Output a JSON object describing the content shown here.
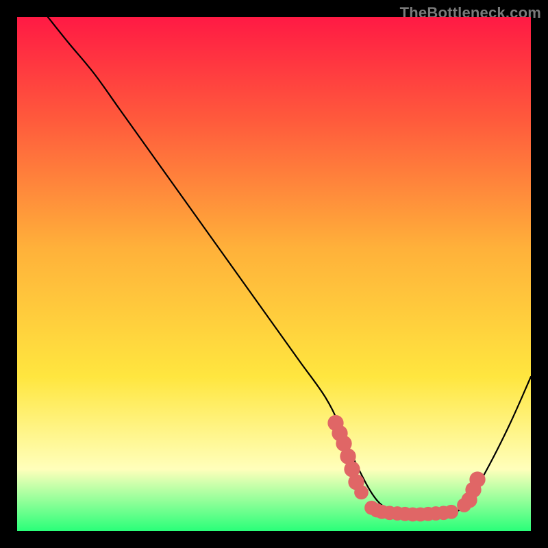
{
  "watermark": "TheBottleneck.com",
  "colors": {
    "background": "#000000",
    "gradient_top": "#ff1a44",
    "gradient_upper": "#ff5a3c",
    "gradient_mid": "#ffb13a",
    "gradient_lower": "#ffe63f",
    "gradient_pale": "#ffffbb",
    "gradient_bottom": "#2aff79",
    "curve": "#000000",
    "dots": "#e06666",
    "watermark": "#7a7a7a"
  },
  "chart_data": {
    "type": "line",
    "title": "",
    "xlabel": "",
    "ylabel": "",
    "xlim": [
      0,
      100
    ],
    "ylim": [
      0,
      100
    ],
    "grid": false,
    "legend": false,
    "series": [
      {
        "name": "bottleneck_curve",
        "x": [
          6,
          10,
          15,
          20,
          25,
          30,
          35,
          40,
          45,
          50,
          55,
          60,
          63,
          66,
          70,
          74,
          78,
          82,
          86,
          88,
          92,
          96,
          100
        ],
        "y": [
          100,
          95,
          89,
          82,
          75,
          68,
          61,
          54,
          47,
          40,
          33,
          26,
          20,
          13,
          6,
          3.5,
          3,
          3,
          4,
          6,
          13,
          21,
          30
        ]
      }
    ],
    "scatter_points": {
      "name": "highlight_dots",
      "points": [
        {
          "x": 62,
          "y": 21,
          "r": 1.2
        },
        {
          "x": 62.8,
          "y": 19,
          "r": 1.2
        },
        {
          "x": 63.6,
          "y": 17,
          "r": 1.2
        },
        {
          "x": 64.4,
          "y": 14.5,
          "r": 1.2
        },
        {
          "x": 65.2,
          "y": 12,
          "r": 1.2
        },
        {
          "x": 66,
          "y": 9.5,
          "r": 1.2
        },
        {
          "x": 67,
          "y": 7.5,
          "r": 1.0
        },
        {
          "x": 69,
          "y": 4.5,
          "r": 1.0
        },
        {
          "x": 70,
          "y": 4,
          "r": 1.0
        },
        {
          "x": 71,
          "y": 3.7,
          "r": 1.0
        },
        {
          "x": 72.5,
          "y": 3.5,
          "r": 1.0
        },
        {
          "x": 74,
          "y": 3.4,
          "r": 1.0
        },
        {
          "x": 75.5,
          "y": 3.3,
          "r": 1.0
        },
        {
          "x": 77,
          "y": 3.2,
          "r": 1.0
        },
        {
          "x": 78.5,
          "y": 3.2,
          "r": 1.0
        },
        {
          "x": 80,
          "y": 3.3,
          "r": 1.0
        },
        {
          "x": 81.5,
          "y": 3.4,
          "r": 1.0
        },
        {
          "x": 83,
          "y": 3.5,
          "r": 1.0
        },
        {
          "x": 84.5,
          "y": 3.7,
          "r": 1.0
        },
        {
          "x": 87,
          "y": 5,
          "r": 1.0
        },
        {
          "x": 88,
          "y": 6,
          "r": 1.2
        },
        {
          "x": 88.8,
          "y": 8,
          "r": 1.2
        },
        {
          "x": 89.6,
          "y": 10,
          "r": 1.2
        }
      ]
    },
    "gradient_stops": [
      {
        "offset": 0.0,
        "color_key": "gradient_top"
      },
      {
        "offset": 0.2,
        "color_key": "gradient_upper"
      },
      {
        "offset": 0.45,
        "color_key": "gradient_mid"
      },
      {
        "offset": 0.7,
        "color_key": "gradient_lower"
      },
      {
        "offset": 0.88,
        "color_key": "gradient_pale"
      },
      {
        "offset": 1.0,
        "color_key": "gradient_bottom"
      }
    ]
  }
}
